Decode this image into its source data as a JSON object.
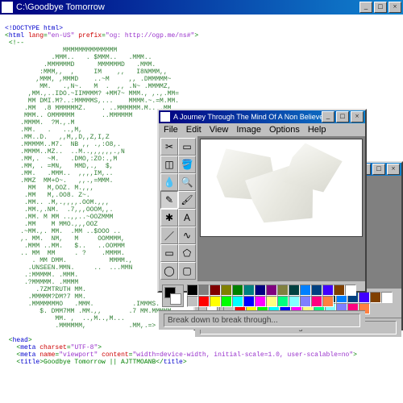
{
  "main_window": {
    "title": "C:\\Goodbye Tomorrow"
  },
  "code": {
    "doctype": "<!DOCTYPE html>",
    "html_open": "<html lang=\"en-US\" prefix=\"og: http://ogp.me/ns#\">",
    "comment_open": "<!--",
    "head": "<head>",
    "meta_charset": "<meta charset=\"UTF-8\">",
    "meta_viewport": "<meta name=\"viewport\" content=\"width=device-width, initial-scale=1.0, user-scalable=no\">",
    "title_tag": "<title>Goodbye Tomorrow || AJTTMOANB</title>"
  },
  "ascii_art": "               MMMMMMMMMMMMMM\n            .MMM..   . $MMM..   .MMM..\n          .MMMMMMD      MMMMMMD   .MMM.\n         :MMM,,  ,     IM    ,,   I8NMMM,,\n        ,MMM, ,MMMD    ..~M     ,, .DMMMMM~\n         MM.   .,N~.   M  .  ,, .N~ .MMMMZ,\n      ,MM.,..IDO.~IIMMMM? +MM7~ MMM., ,.,.MM=\n      MM DMI.M?..:MMMMMS,...    MMMM.~.=M.MM.\n     .MM  .8 MMMMMMZ.    . ..MMMMMM.M.. .MM\n     MMM.. OMMMMMM       ..MMMMMM\n    .MMMM.  ?M.,.M\n    .MM.   .   ..,M,\n    .MM..D.   ,,M,,D,,Z,I,Z\n    .MMMMM..M7.  NB ,, .,:O8,.\n    .MMMM..MZ..  ..M..,,,,,,.,N\n    .MM,.  ~M.   .DMO,:ZO:.,M\n    .MM, . =MN,   MMD,.,  $,\n    .MM.   .MMM..  ,,,,IM,..\n    .MMZ  MM+O~.   ,,.,=MMM.\n      MM   M,OOZ. M.,,,\n     .MM   M,.OO8. Z~.\n     .MM.. .M,.,,,,.OOM.,,,\n     .MM.,.NM.  .7,,,OOOM,,.\n     .MM. M MM ..,,..~OOZMMM\n     .MM    M MMO.,,,OOZ\n    .~MM.,. MM.  .MM ..$OOO ..\n    ,. MM.  NM,   M     OOMMMM,\n     .MMM ..MM.   $..   ..OOMMM\n    .. MM  MM     . ?    .MMMM.\n       . MM DMM.           MMMM.,\n      .UNSEEN.MMN.     ..  ...MMN\n     .:MMMMM. .MMM.\n     .?MMMMM. .MMMM\n        .7ZMTRUTH MM.\n      .MMMMM?DM?7 MM.\n      .MMMMMMMO   .MMM.          .IMMMS.\n         $. DMM7MM .MM.,,       .7 MM.MMMMM,\n             MM. ,  ..,M..,M...\n             .MMMMMM,           .MM,.=>",
  "paint": {
    "title": "A Journey Through The Mind Of A Non Believer",
    "menu": {
      "file": "File",
      "edit": "Edit",
      "view": "View",
      "image": "Image",
      "options": "Options",
      "help": "Help"
    },
    "status": "Break down to break through...",
    "palette": [
      "#000000",
      "#808080",
      "#800000",
      "#808000",
      "#008000",
      "#008080",
      "#000080",
      "#800080",
      "#808040",
      "#004040",
      "#0080ff",
      "#004080",
      "#4000ff",
      "#804000",
      "#ffffff",
      "#c0c0c0",
      "#ff0000",
      "#ffff00",
      "#00ff00",
      "#00ffff",
      "#0000ff",
      "#ff00ff",
      "#ffff80",
      "#00ff80",
      "#80ffff",
      "#8080ff",
      "#ff0080",
      "#ff8040"
    ],
    "tools": [
      "free-select",
      "rect-select",
      "eraser",
      "fill",
      "picker",
      "magnify",
      "pencil",
      "brush",
      "spray",
      "text",
      "line",
      "curve",
      "rect",
      "polygon",
      "ellipse",
      "rounded-rect"
    ]
  }
}
